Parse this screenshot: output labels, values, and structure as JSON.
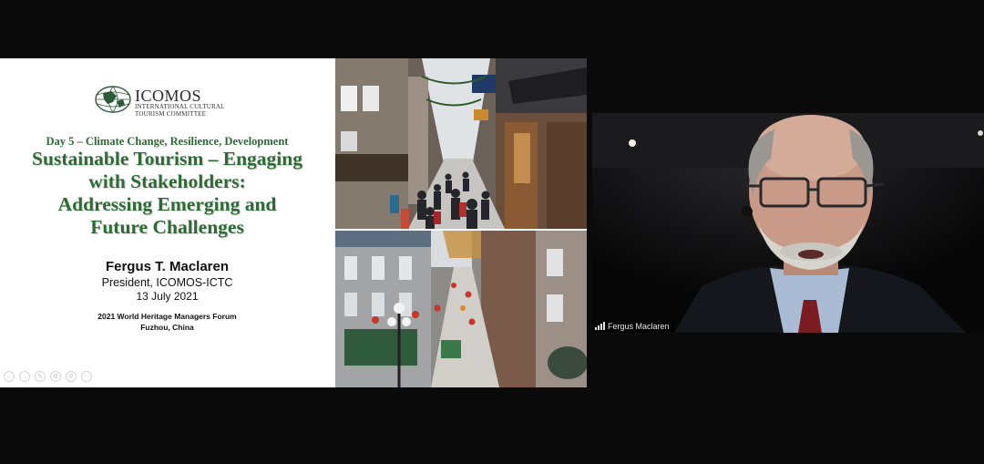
{
  "slide": {
    "logo": {
      "name": "ICOMOS",
      "subtitle": "International Cultural Tourism Committee",
      "icon": "globe-logo-icon"
    },
    "day_line": "Day 5 – Climate Change, Resilience, Development",
    "title_lines": [
      "Sustainable Tourism – Engaging",
      "with Stakeholders:",
      "Addressing Emerging and",
      "Future Challenges"
    ],
    "presenter": "Fergus T. Maclaren",
    "role": "President, ICOMOS-ICTC",
    "date": "13 July 2021",
    "forum": "2021 World Heritage Managers Forum",
    "location": "Fuzhou, China",
    "toolbar_icons": [
      "back-icon",
      "forward-icon",
      "pen-icon",
      "gear-icon",
      "zoom-icon",
      "more-icon"
    ],
    "accent_color": "#2e6b34"
  },
  "video": {
    "participant_name": "Fergus Maclaren",
    "icon": "signal-strength-icon"
  }
}
